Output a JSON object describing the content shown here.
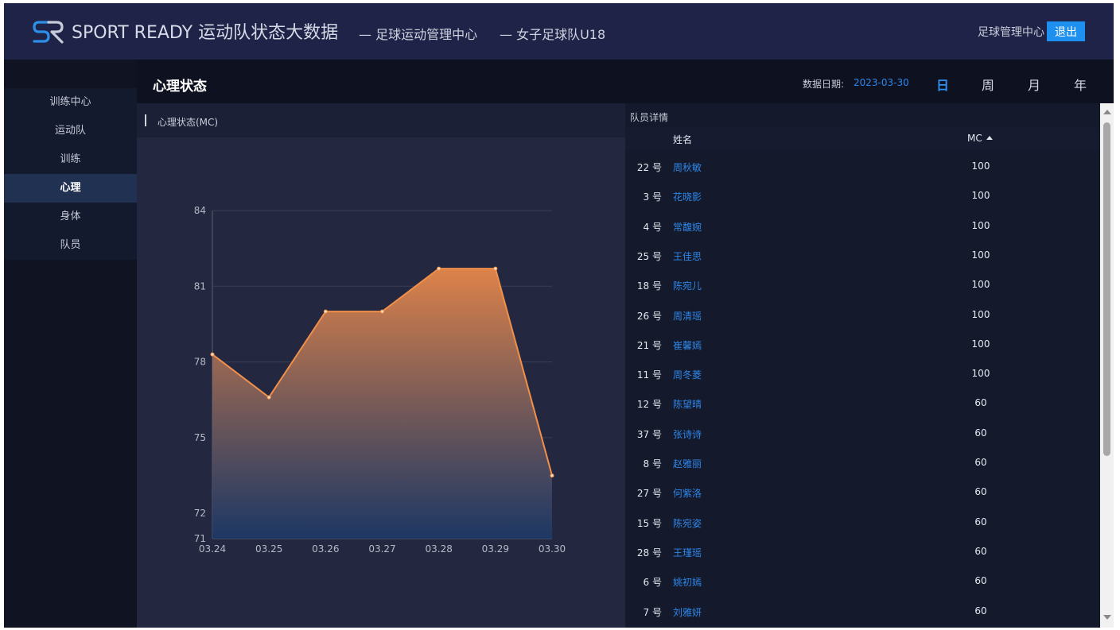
{
  "header": {
    "brand": "SPORT READY 运动队状态大数据",
    "crumb1": "— 足球运动管理中心",
    "crumb2": "— 女子足球队U18",
    "user": "足球管理中心",
    "logout": "退出"
  },
  "sidebar": {
    "items": [
      {
        "label": "训练中心",
        "active": false
      },
      {
        "label": "运动队",
        "active": false
      },
      {
        "label": "训练",
        "active": false
      },
      {
        "label": "心理",
        "active": true
      },
      {
        "label": "身体",
        "active": false
      },
      {
        "label": "队员",
        "active": false
      }
    ]
  },
  "content": {
    "title": "心理状态",
    "date_label": "数据日期:",
    "date_value": "2023-03-30",
    "periods": [
      "日",
      "周",
      "月",
      "年"
    ],
    "active_period": "日"
  },
  "chart_panel": {
    "title": "心理状态(MC)"
  },
  "chart_data": {
    "type": "area",
    "title": "",
    "xlabel": "",
    "ylabel": "",
    "x": [
      "03.24",
      "03.25",
      "03.26",
      "03.27",
      "03.28",
      "03.29",
      "03.30"
    ],
    "series": [
      {
        "values": [
          78.3,
          76.6,
          80.0,
          80.0,
          81.7,
          81.7,
          73.5
        ]
      }
    ],
    "ylim": [
      71,
      84
    ],
    "yticks": [
      71,
      72,
      75,
      78,
      81,
      84
    ],
    "grid": true,
    "colors": {
      "line": "#f0904a",
      "fill_top": "#e8874a",
      "fill_bottom": "#1c3a6a"
    }
  },
  "table": {
    "caption": "队员详情",
    "headers": {
      "name": "姓名",
      "mc": "MC"
    },
    "rows": [
      {
        "num": "22 号",
        "name": "周秋敏",
        "mc": "100"
      },
      {
        "num": "3 号",
        "name": "花晓影",
        "mc": "100"
      },
      {
        "num": "4 号",
        "name": "常馥婉",
        "mc": "100"
      },
      {
        "num": "25 号",
        "name": "王佳思",
        "mc": "100"
      },
      {
        "num": "18 号",
        "name": "陈宛儿",
        "mc": "100"
      },
      {
        "num": "26 号",
        "name": "周清瑶",
        "mc": "100"
      },
      {
        "num": "21 号",
        "name": "崔馨嫣",
        "mc": "100"
      },
      {
        "num": "11 号",
        "name": "周冬菱",
        "mc": "100"
      },
      {
        "num": "12 号",
        "name": "陈望晴",
        "mc": "60"
      },
      {
        "num": "37 号",
        "name": "张诗诗",
        "mc": "60"
      },
      {
        "num": "8 号",
        "name": "赵雅丽",
        "mc": "60"
      },
      {
        "num": "27 号",
        "name": "何紫洛",
        "mc": "60"
      },
      {
        "num": "15 号",
        "name": "陈宛姿",
        "mc": "60"
      },
      {
        "num": "28 号",
        "name": "王瑾瑶",
        "mc": "60"
      },
      {
        "num": "6 号",
        "name": "姚初嫣",
        "mc": "60"
      },
      {
        "num": "7 号",
        "name": "刘雅妍",
        "mc": "60"
      }
    ]
  },
  "icons": {
    "logo": "sport-ready-logo",
    "sort": "sort-ascending-icon",
    "scroll_up": "scroll-up-arrow",
    "scroll_down": "scroll-down-arrow"
  }
}
